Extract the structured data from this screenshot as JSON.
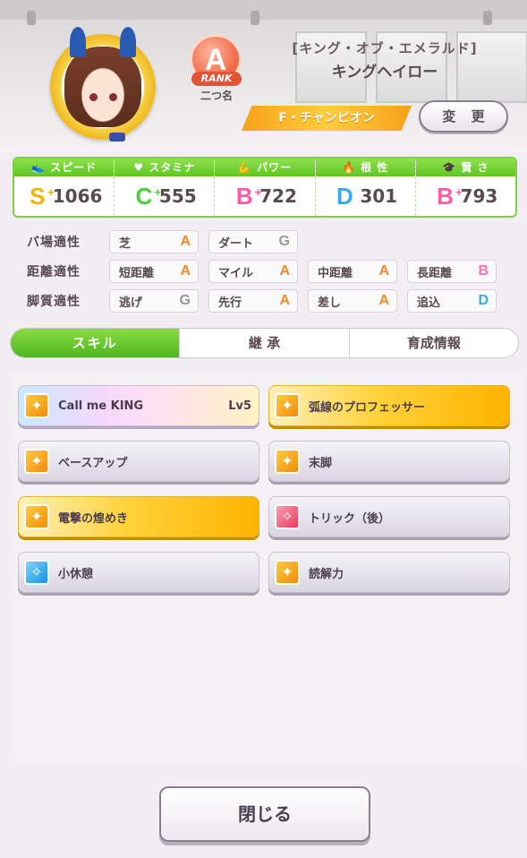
{
  "header": {
    "rank_letter": "A",
    "rank_label": "RANK",
    "nickname": "二つ名",
    "outfit_title": "[キング・オブ・エメラルド]",
    "character_name": "キングヘイロー",
    "epithet": "F・チャンピオン",
    "change_label": "変 更"
  },
  "stats": [
    {
      "label": "スピード",
      "icon": "shoe-icon",
      "grade": "S",
      "value": "1066",
      "color": "#f5b400"
    },
    {
      "label": "スタミナ",
      "icon": "heart-icon",
      "grade": "C",
      "value": "555",
      "color": "#4ccf3a"
    },
    {
      "label": "パワー",
      "icon": "muscle-icon",
      "grade": "B",
      "value": "722",
      "color": "#ff5aa5"
    },
    {
      "label": "根 性",
      "icon": "flame-icon",
      "grade": "D",
      "value": "301",
      "color": "#3aa9f0"
    },
    {
      "label": "賢 さ",
      "icon": "graduation-cap-icon",
      "grade": "B",
      "value": "793",
      "color": "#ff5aa5"
    }
  ],
  "aptitude": {
    "track": {
      "label": "バ場適性",
      "items": [
        {
          "name": "芝",
          "grade": "A"
        },
        {
          "name": "ダート",
          "grade": "G"
        }
      ]
    },
    "distance": {
      "label": "距離適性",
      "items": [
        {
          "name": "短距離",
          "grade": "A"
        },
        {
          "name": "マイル",
          "grade": "A"
        },
        {
          "name": "中距離",
          "grade": "A"
        },
        {
          "name": "長距離",
          "grade": "B"
        }
      ]
    },
    "style": {
      "label": "脚質適性",
      "items": [
        {
          "name": "逃げ",
          "grade": "G"
        },
        {
          "name": "先行",
          "grade": "A"
        },
        {
          "name": "差し",
          "grade": "A"
        },
        {
          "name": "追込",
          "grade": "D"
        }
      ]
    }
  },
  "grade_colors": {
    "A": "#f08a2a",
    "B": "#ff6fb0",
    "D": "#3aa9f0",
    "G": "#9a9a9a"
  },
  "tabs": [
    {
      "label": "スキル",
      "active": true
    },
    {
      "label": "継 承",
      "active": false
    },
    {
      "label": "育成情報",
      "active": false
    }
  ],
  "skills": [
    {
      "name": "Call me KING",
      "level": "Lv5"
    },
    {
      "name": "弧線のプロフェッサー"
    },
    {
      "name": "ベースアップ"
    },
    {
      "name": "末脚"
    },
    {
      "name": "電撃の煌めき"
    },
    {
      "name": "トリック（後）"
    },
    {
      "name": "小休憩"
    },
    {
      "name": "読解力"
    }
  ],
  "close_label": "閉じる"
}
